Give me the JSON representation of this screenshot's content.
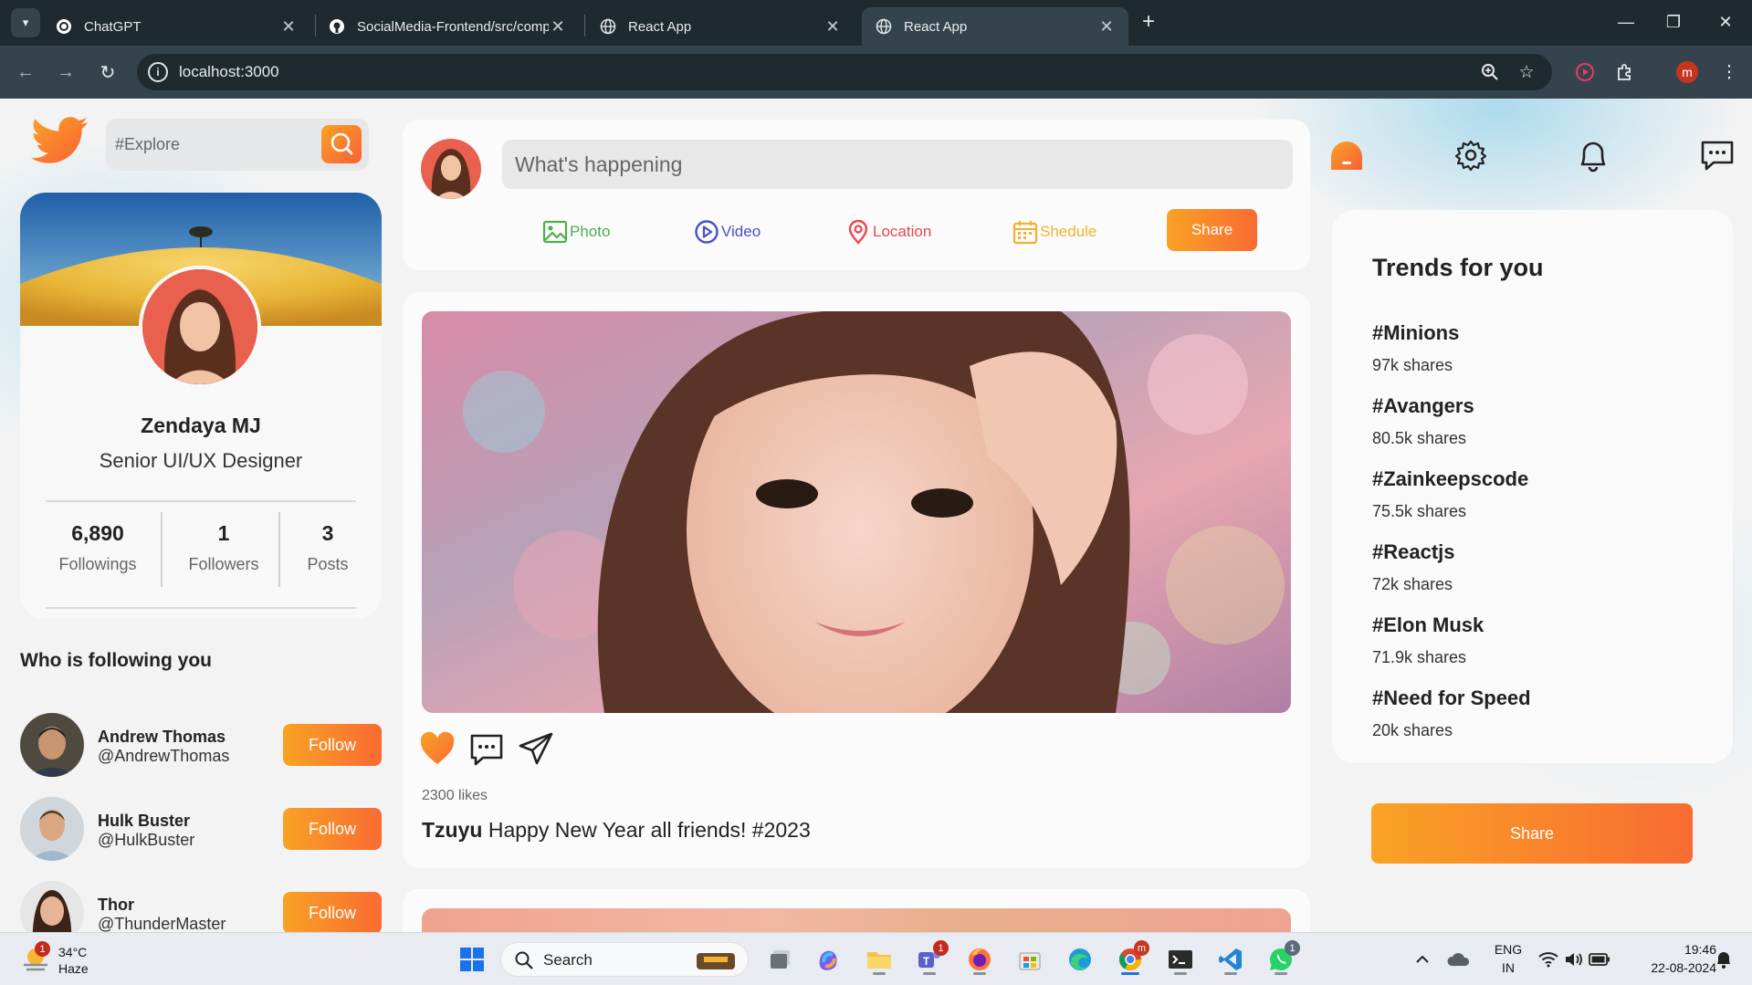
{
  "browser": {
    "tabs": [
      {
        "title": "ChatGPT",
        "favicon": "chatgpt-icon",
        "active": false
      },
      {
        "title": "SocialMedia-Frontend/src/comp",
        "favicon": "github-icon",
        "active": false
      },
      {
        "title": "React App",
        "favicon": "globe-icon",
        "active": false
      },
      {
        "title": "React App",
        "favicon": "globe-icon",
        "active": true
      }
    ],
    "url": "localhost:3000",
    "profile_initial": "m"
  },
  "left": {
    "explore_placeholder": "#Explore",
    "profile": {
      "name": "Zendaya MJ",
      "role": "Senior UI/UX Designer",
      "stats": [
        {
          "value": "6,890",
          "label": "Followings"
        },
        {
          "value": "1",
          "label": "Followers"
        },
        {
          "value": "3",
          "label": "Posts"
        }
      ]
    },
    "followers_title": "Who is following you",
    "followers": [
      {
        "name": "Andrew Thomas",
        "handle": "@AndrewThomas",
        "button": "Follow"
      },
      {
        "name": "Hulk Buster",
        "handle": "@HulkBuster",
        "button": "Follow"
      },
      {
        "name": "Thor",
        "handle": "@ThunderMaster",
        "button": "Follow"
      }
    ]
  },
  "composer": {
    "placeholder": "What's happening",
    "options": [
      {
        "label": "Photo",
        "color": "#4caf50"
      },
      {
        "label": "Video",
        "color": "#4a4fc8"
      },
      {
        "label": "Location",
        "color": "#e8484f"
      },
      {
        "label": "Shedule",
        "color": "#f0b133"
      }
    ],
    "share_label": "Share"
  },
  "post": {
    "likes": "2300 likes",
    "author": "Tzuyu",
    "text": "Happy New Year all friends! #2023"
  },
  "right": {
    "trends_title": "Trends for you",
    "trends": [
      {
        "tag": "#Minions",
        "shares": "97k shares"
      },
      {
        "tag": "#Avangers",
        "shares": "80.5k shares"
      },
      {
        "tag": "#Zainkeepscode",
        "shares": "75.5k shares"
      },
      {
        "tag": "#Reactjs",
        "shares": "72k shares"
      },
      {
        "tag": "#Elon Musk",
        "shares": "71.9k shares"
      },
      {
        "tag": "#Need for Speed",
        "shares": "20k shares"
      }
    ],
    "share_label": "Share"
  },
  "taskbar": {
    "weather_temp": "34°C",
    "weather_desc": "Haze",
    "weather_badge": "1",
    "search_label": "Search",
    "lang_top": "ENG",
    "lang_bottom": "IN",
    "time": "19:46",
    "date": "22-08-2024",
    "teams_badge": "1",
    "whatsapp_badge": "1"
  },
  "colors": {
    "accent_start": "#f9a225",
    "accent_end": "#f96b32"
  }
}
